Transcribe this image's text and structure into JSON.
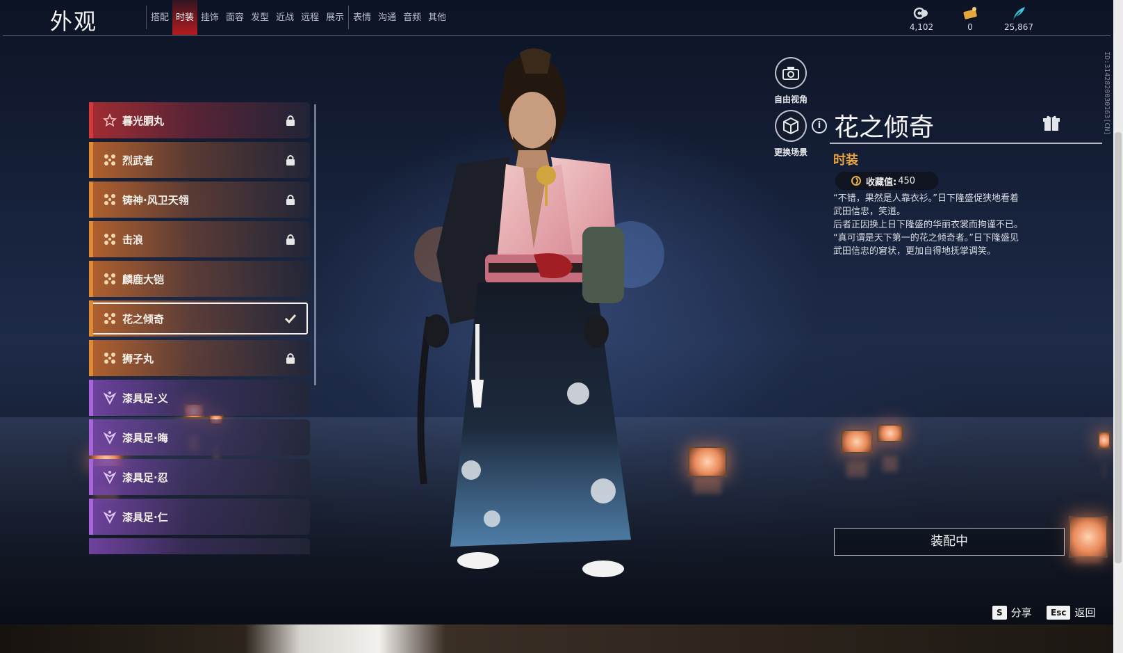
{
  "header": {
    "title": "外观",
    "tabs": [
      {
        "label": "搭配"
      },
      {
        "label": "时装"
      },
      {
        "label": "挂饰"
      },
      {
        "label": "面容"
      },
      {
        "label": "发型"
      },
      {
        "label": "近战"
      },
      {
        "label": "远程"
      },
      {
        "label": "展示"
      },
      {
        "label": "表情"
      },
      {
        "label": "沟通"
      },
      {
        "label": "音频"
      },
      {
        "label": "其他"
      }
    ],
    "active_tab": "时装",
    "currencies": [
      {
        "icon": "crystal-orb-icon",
        "value": "4,102"
      },
      {
        "icon": "ticket-icon",
        "value": "0"
      },
      {
        "icon": "feather-icon",
        "value": "25,867"
      }
    ]
  },
  "outfits": [
    {
      "name": "暮光胴丸",
      "rarity": "red",
      "locked": true
    },
    {
      "name": "烈武者",
      "rarity": "orange",
      "locked": true
    },
    {
      "name": "铸神·风卫天翎",
      "rarity": "orange",
      "locked": true
    },
    {
      "name": "击浪",
      "rarity": "orange",
      "locked": true
    },
    {
      "name": "麟鹿大铠",
      "rarity": "orange",
      "locked": false
    },
    {
      "name": "花之倾奇",
      "rarity": "orange",
      "locked": false,
      "selected": true
    },
    {
      "name": "狮子丸",
      "rarity": "orange",
      "locked": true
    },
    {
      "name": "漆具足·义",
      "rarity": "purple",
      "locked": false
    },
    {
      "name": "漆具足·晦",
      "rarity": "purple",
      "locked": false
    },
    {
      "name": "漆具足·忍",
      "rarity": "purple",
      "locked": false
    },
    {
      "name": "漆具足·仁",
      "rarity": "purple",
      "locked": false
    }
  ],
  "camera": {
    "free_view_label": "自由视角",
    "change_scene_label": "更换场景"
  },
  "detail": {
    "name": "花之倾奇",
    "category": "时装",
    "collect_label": "收藏值:",
    "collect_value": "450",
    "description": "“不错，果然是人靠衣衫。”日下隆盛促狭地看着\n武田信忠，笑道。\n后者正因换上日下隆盛的华丽衣裳而拘谨不已。\n“真可谓是天下第一的花之倾奇者。”日下隆盛见\n武田信忠的窘状，更加自得地抚掌调笑。",
    "equip_button": "装配中"
  },
  "hints": {
    "share_key": "S",
    "share_label": "分享",
    "back_key": "Esc",
    "back_label": "返回"
  },
  "side_id": "ID:3142820030163[CN]",
  "colors": {
    "red": "#d23a3a",
    "orange": "#e08a34",
    "purple": "#a764db",
    "category": "#e7a23f",
    "active_tab": "#d21e1e"
  }
}
